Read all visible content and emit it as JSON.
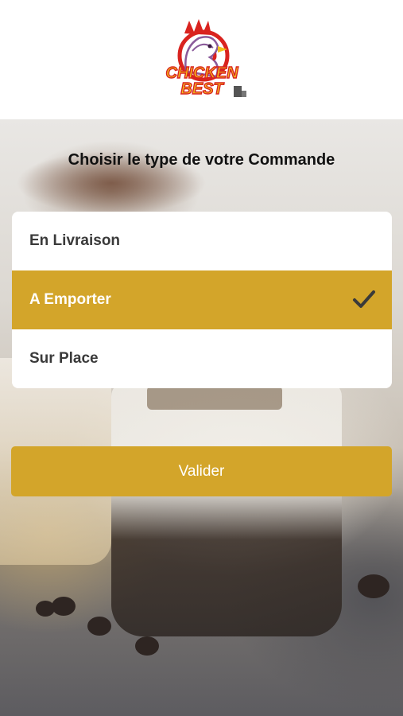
{
  "header": {
    "logo": {
      "icon": "chicken-best-logo",
      "brand_line1": "CHICKEN",
      "brand_line2": "BEST",
      "colors": {
        "red": "#d9231f",
        "yellow": "#f2c21b"
      }
    }
  },
  "main": {
    "title": "Choisir le type de votre Commande",
    "options": [
      {
        "label": "En Livraison",
        "selected": false
      },
      {
        "label": "A Emporter",
        "selected": true
      },
      {
        "label": "Sur Place",
        "selected": false
      }
    ],
    "selected_icon": "checkmark-icon",
    "validate_label": "Valider"
  },
  "theme": {
    "accent": "#d3a52a",
    "text_dark": "#3a3a3a",
    "card_bg": "#ffffff"
  }
}
